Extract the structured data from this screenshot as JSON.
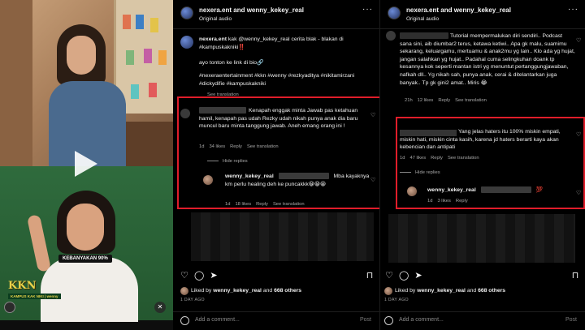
{
  "video": {
    "caption": "KEBANYAKAN 90%",
    "logo": "KKN",
    "logo_sub": "KAMPUS KAK NIKI | wenny"
  },
  "left_panel": {
    "header": {
      "name": "nexera.ent and wenny_kekey_real",
      "sub": "Original audio"
    },
    "caption": {
      "user": "nexera.ent",
      "text": "kak @wenny_kekey_real cerita blak - blakan di #kampuskakniki‼️",
      "line2": "ayo tonton ke link di bio🔗",
      "hashtags": "#nexeraentertainment #kkn #wenny #rezkyaditya #nikitamirzani #dickydifie #kampuskakniki",
      "see_translation": "See translation"
    },
    "comment1": {
      "text": "Kenapah enggak minta Jawab pas ketahuan hamil, kenapah pas udah Rezky udah nikah punya anak dia baru muncul baru minta tanggung jawab. Aneh emang orang ini !",
      "time": "1d",
      "likes": "34 likes",
      "reply": "Reply",
      "see_translation": "See translation",
      "hide_replies": "Hide replies"
    },
    "reply1": {
      "user": "wenny_kekey_real",
      "text": "Mba kayaknya km perlu healing deh ke puncakkk😀😀😀",
      "time": "1d",
      "likes": "18 likes",
      "reply": "Reply",
      "see_translation": "See translation"
    },
    "liked_by": {
      "prefix": "Liked by ",
      "user": "wenny_kekey_real",
      "mid": " and ",
      "others": "668 others"
    },
    "ago": "1 DAY AGO",
    "add_comment": "Add a comment...",
    "post": "Post"
  },
  "right_panel": {
    "header": {
      "name": "nexera.ent and wenny_kekey_real",
      "sub": "Original audio"
    },
    "comment_top": {
      "text": "Tutorial mempermalukan diri sendiri.. Podcast sana sini, aib diumbar2 terus, ketawa ketiwi.. Apa gk malu, suamimu sekarang, keluargamu, mertuamu & anak2mu yg lain.. Klo ada yg hujat, jangan salahkan yg hujat.. Padahal cuma selingkuhan doank tp kesannya kok seperti mantan istri yg menuntut pertanggungjawaban, nafkah dll.. Yg nikah sah, punya anak, cerai & ditelantarkan juga banyak.. Tp gk gini2 amat.. Miris 😂",
      "time": "21h",
      "likes": "12 likes",
      "reply": "Reply",
      "see_translation": "See translation"
    },
    "comment2": {
      "text": "Yang jelas haters itu 100% miskin empati, miskin hati, miskin cinta kasih, karena jd haters berarti kaya akan kebencian dan antipati",
      "time": "1d",
      "likes": "47 likes",
      "reply": "Reply",
      "see_translation": "See translation",
      "hide_replies": "Hide replies"
    },
    "reply2": {
      "user": "wenny_kekey_real",
      "text": "💯",
      "time": "1d",
      "likes": "3 likes",
      "reply": "Reply"
    },
    "liked_by": {
      "prefix": "Liked by ",
      "user": "wenny_kekey_real",
      "mid": " and ",
      "others": "668 others"
    },
    "ago": "1 DAY AGO",
    "add_comment": "Add a comment...",
    "post": "Post"
  },
  "colors": {
    "highlight": "#e01d2a",
    "background": "#000000",
    "text": "#f5f5f5"
  },
  "icons": [
    "heart-icon",
    "comment-icon",
    "share-icon",
    "bookmark-icon",
    "more-icon",
    "emoji-icon",
    "play-icon",
    "mute-icon"
  ]
}
